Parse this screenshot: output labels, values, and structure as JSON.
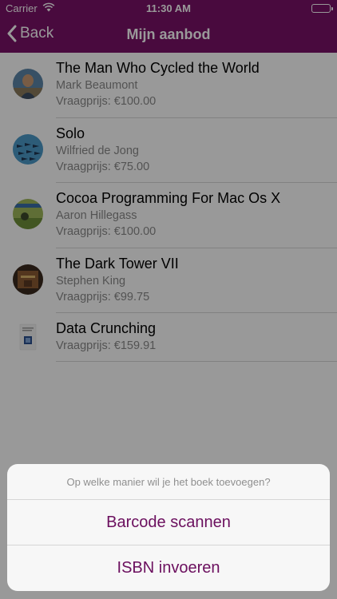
{
  "status_bar": {
    "carrier": "Carrier",
    "time": "11:30 AM"
  },
  "nav": {
    "back_label": "Back",
    "title": "Mijn aanbod"
  },
  "books": [
    {
      "title": "The Man Who Cycled the World",
      "author": "Mark Beaumont",
      "price": "Vraagprijs: €100.00"
    },
    {
      "title": "Solo",
      "author": "Wilfried de Jong",
      "price": "Vraagprijs: €75.00"
    },
    {
      "title": "Cocoa Programming For Mac Os X",
      "author": "Aaron Hillegass",
      "price": "Vraagprijs: €100.00"
    },
    {
      "title": "The Dark Tower VII",
      "author": "Stephen King",
      "price": "Vraagprijs: €99.75"
    },
    {
      "title": "Data Crunching",
      "author": "",
      "price": "Vraagprijs: €159.91"
    }
  ],
  "action_sheet": {
    "question": "Op welke manier wil je het boek toevoegen?",
    "barcode_label": "Barcode scannen",
    "isbn_label": "ISBN invoeren"
  },
  "colors": {
    "brand": "#7b1168",
    "action_text": "#6b0f5e"
  }
}
